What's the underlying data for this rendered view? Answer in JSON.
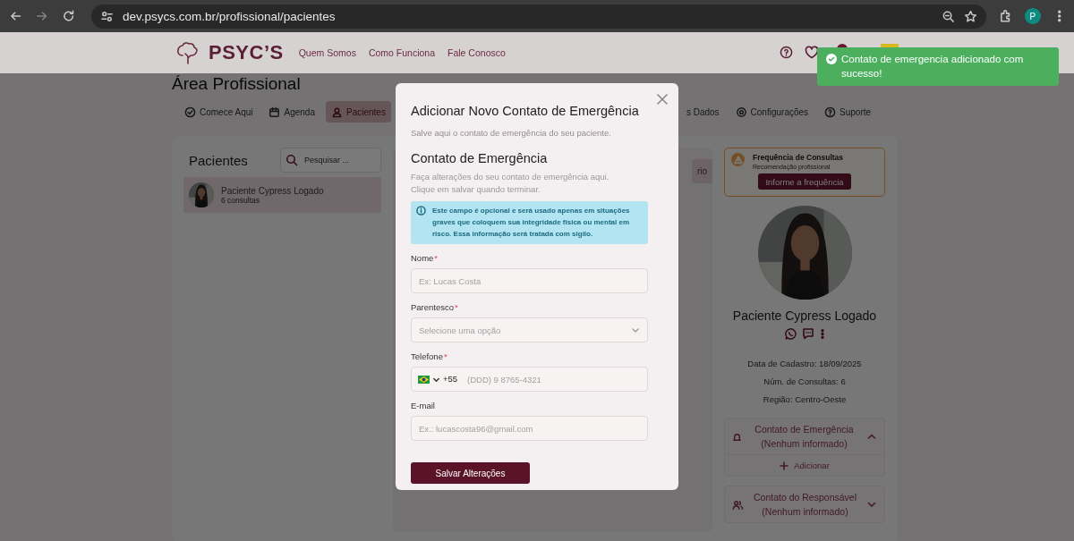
{
  "browser": {
    "url": "dev.psycs.com.br/profissional/pacientes",
    "profile_initial": "P"
  },
  "header": {
    "logo": "PSYC’S",
    "nav": [
      "Quem Somos",
      "Como Funciona",
      "Fale Conosco"
    ]
  },
  "page": {
    "title": "Área Profissional",
    "tabs": [
      {
        "label": "Comece Aqui",
        "selected": false
      },
      {
        "label": "Agenda",
        "selected": false
      },
      {
        "label": "Pacientes",
        "selected": true
      },
      {
        "label": "s Dados",
        "selected": false
      },
      {
        "label": "Configurações",
        "selected": false
      },
      {
        "label": "Suporte",
        "selected": false
      }
    ]
  },
  "patients_panel": {
    "title": "Pacientes",
    "search": {
      "placeholder": "Pesquisar ..."
    },
    "patients": [
      {
        "name": "Paciente Cypress Logado",
        "detail": "6 consultas",
        "selected": true
      }
    ]
  },
  "detail_panel": {
    "button": "rio"
  },
  "profile": {
    "frequency": {
      "title": "Frequência de Consultas",
      "subtitle": "Recomendação profissional",
      "button": "Informe a frequência"
    },
    "name": "Paciente Cypress Logado",
    "details": [
      "Data de Cadastro: 18/09/2025",
      "Núm. de Consultas: 6",
      "Região: Centro-Oeste"
    ],
    "sections": [
      {
        "title": "Contato de Emergência",
        "subtitle": "(Nenhum informado)",
        "expanded": true,
        "action": "Adicionar"
      },
      {
        "title": "Contato do Responsável",
        "subtitle": "(Nenhum informado)",
        "expanded": false
      }
    ]
  },
  "modal": {
    "title": "Adicionar Novo Contato de Emergência",
    "subtitle": "Salve aqui o contato de emergência do seu paciente.",
    "section_title": "Contato de Emergência",
    "description": "Faça alterações do seu contato de emergência aqui. Clique em salvar quando terminar.",
    "info": "Este campo é opcional e será usado apenas em situações graves que coloquem sua integridade física ou mental em risco. Essa informação será tratada com sigilo.",
    "fields": [
      {
        "kind": "text",
        "label": "Nome",
        "required_mark": "*",
        "placeholder": "Ex: Lucas Costa"
      },
      {
        "kind": "select",
        "label": "Parentesco",
        "required_mark": "*",
        "placeholder": "Selecione uma opção"
      },
      {
        "kind": "phone",
        "label": "Telefone",
        "required_mark": "*",
        "country_code": "+55",
        "placeholder": "(DDD) 9 8765-4321"
      },
      {
        "kind": "text",
        "label": "E-mail",
        "placeholder": "Ex.: lucascosta96@gmail.com"
      }
    ],
    "button": "Salvar Alterações"
  },
  "toast": {
    "message": "Contato de emergencia adicionado com sucesso!"
  }
}
